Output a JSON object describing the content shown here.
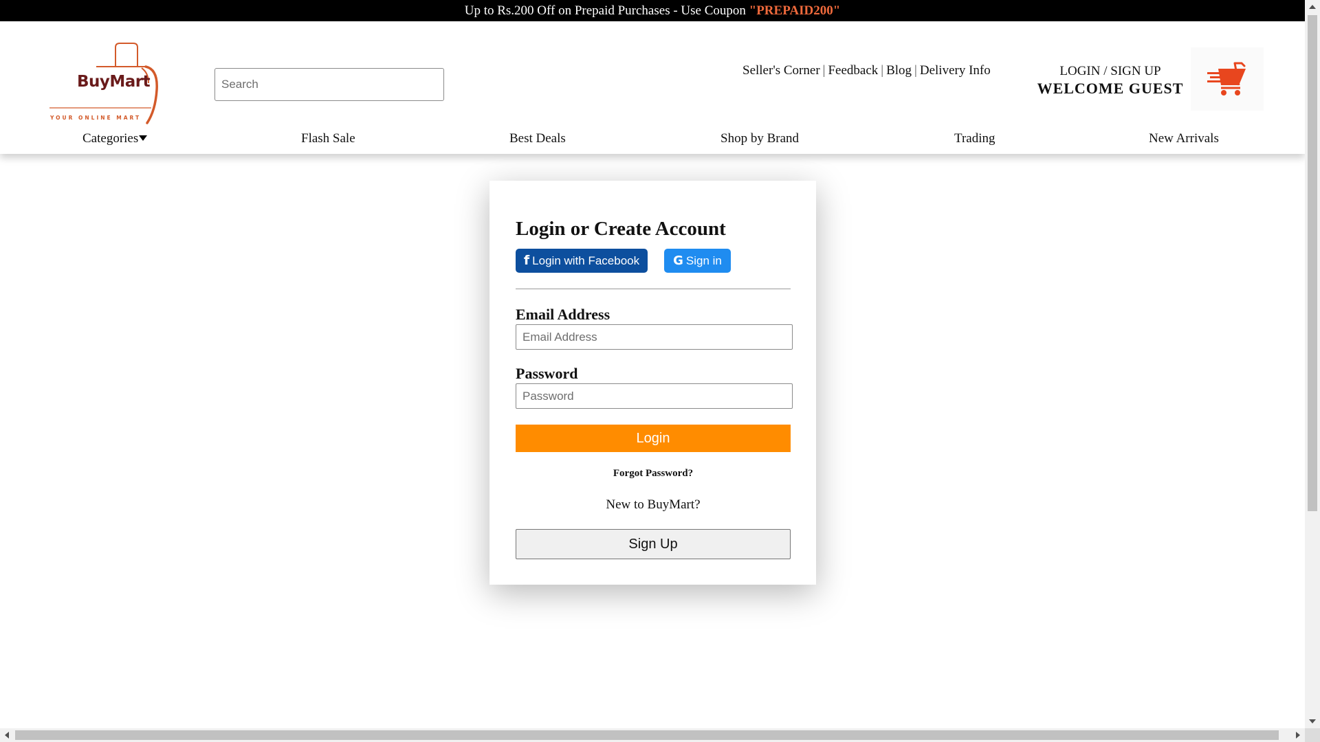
{
  "promo": {
    "text": "Up to Rs.200 Off on Prepaid Purchases - Use Coupon ",
    "coupon": "\"PREPAID200\"",
    "coupon_color": "#f06a3c"
  },
  "brand": {
    "name": "BuyMart",
    "tagline": "YOUR ONLINE MART",
    "primary_color": "#6a1b1b",
    "accent_color": "#d35a2a"
  },
  "search": {
    "placeholder": "Search",
    "value": ""
  },
  "toplinks": {
    "items": [
      "Seller's Corner",
      "Feedback",
      "Blog",
      "Delivery Info"
    ],
    "separator": "|"
  },
  "account": {
    "login_label": "LOGIN / SIGN UP",
    "welcome": "WELCOME GUEST"
  },
  "cart": {
    "icon": "shopping-cart-icon",
    "color": "#e8461e"
  },
  "nav": {
    "items": [
      {
        "label": "Categories",
        "has_dropdown": true
      },
      {
        "label": "Flash Sale"
      },
      {
        "label": "Best Deals"
      },
      {
        "label": "Shop by Brand"
      },
      {
        "label": "Trading"
      },
      {
        "label": "New Arrivals"
      }
    ]
  },
  "login_card": {
    "title": "Login or Create Account",
    "facebook_label": "Login with Facebook",
    "facebook_icon": "facebook-icon",
    "facebook_color": "#0d4f9e",
    "google_label": "Sign in",
    "google_icon": "google-icon",
    "google_color": "#1f8cf0",
    "email": {
      "label": "Email Address",
      "placeholder": "Email Address",
      "value": ""
    },
    "password": {
      "label": "Password",
      "placeholder": "Password",
      "value": ""
    },
    "login_button": "Login",
    "login_button_color": "#ff8c00",
    "forgot_password": "Forgot Password?",
    "new_to": "New to BuyMart?",
    "signup_button": "Sign Up"
  }
}
